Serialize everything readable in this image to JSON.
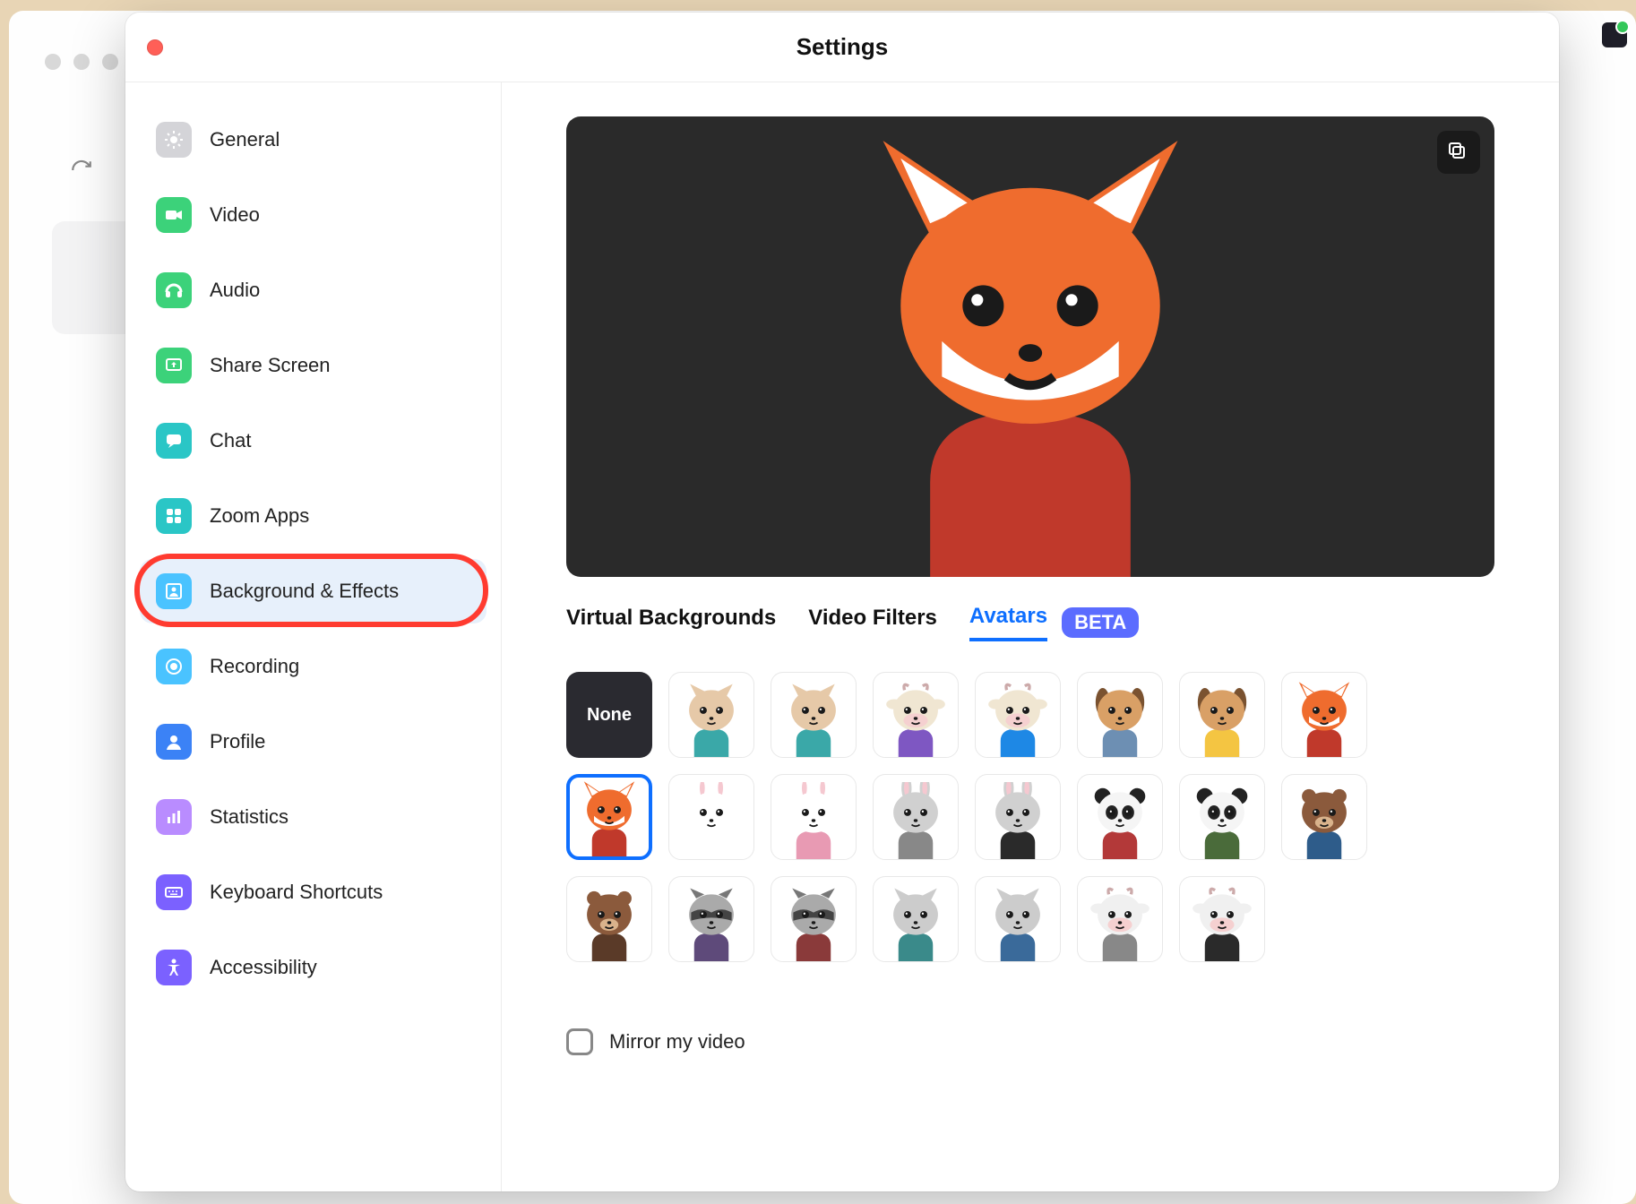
{
  "window": {
    "title": "Settings"
  },
  "sidebar": {
    "items": [
      {
        "id": "general",
        "label": "General",
        "color": "#d4d4d8",
        "active": false,
        "highlight": false
      },
      {
        "id": "video",
        "label": "Video",
        "color": "#3cd27a",
        "active": false,
        "highlight": false
      },
      {
        "id": "audio",
        "label": "Audio",
        "color": "#3cd27a",
        "active": false,
        "highlight": false
      },
      {
        "id": "share-screen",
        "label": "Share Screen",
        "color": "#3cd27a",
        "active": false,
        "highlight": false
      },
      {
        "id": "chat",
        "label": "Chat",
        "color": "#2ac6c6",
        "active": false,
        "highlight": false
      },
      {
        "id": "zoom-apps",
        "label": "Zoom Apps",
        "color": "#2ac6c6",
        "active": false,
        "highlight": false
      },
      {
        "id": "background-effects",
        "label": "Background & Effects",
        "color": "#4ac3ff",
        "active": true,
        "highlight": true
      },
      {
        "id": "recording",
        "label": "Recording",
        "color": "#4ac3ff",
        "active": false,
        "highlight": false
      },
      {
        "id": "profile",
        "label": "Profile",
        "color": "#3b82f6",
        "active": false,
        "highlight": false
      },
      {
        "id": "statistics",
        "label": "Statistics",
        "color": "#b98cff",
        "active": false,
        "highlight": false
      },
      {
        "id": "keyboard-shortcuts",
        "label": "Keyboard Shortcuts",
        "color": "#7b61ff",
        "active": false,
        "highlight": false
      },
      {
        "id": "accessibility",
        "label": "Accessibility",
        "color": "#7b61ff",
        "active": false,
        "highlight": false
      }
    ]
  },
  "tabs": [
    {
      "id": "virtual-backgrounds",
      "label": "Virtual Backgrounds",
      "active": false,
      "badge": null
    },
    {
      "id": "video-filters",
      "label": "Video Filters",
      "active": false,
      "badge": null
    },
    {
      "id": "avatars",
      "label": "Avatars",
      "active": true,
      "badge": "BETA"
    }
  ],
  "avatars": {
    "none_label": "None",
    "selected_index": 8,
    "items": [
      {
        "id": "none",
        "type": "none"
      },
      {
        "id": "cat-teal",
        "animal": "cat",
        "face": "#e6c9a8",
        "shirt": "#3aa8a8"
      },
      {
        "id": "cat-teal2",
        "animal": "cat",
        "face": "#e6c9a8",
        "shirt": "#3aa8a8"
      },
      {
        "id": "cow-purple",
        "animal": "cow",
        "face": "#f0e6d2",
        "shirt": "#7e57c2"
      },
      {
        "id": "cow-blue",
        "animal": "cow",
        "face": "#f0e6d2",
        "shirt": "#1e88e5"
      },
      {
        "id": "dog-blue",
        "animal": "dog",
        "face": "#d9a066",
        "shirt": "#6d8fb3"
      },
      {
        "id": "dog-yellow",
        "animal": "dog",
        "face": "#d9a066",
        "shirt": "#f4c542"
      },
      {
        "id": "fox-red",
        "animal": "fox",
        "face": "#ef6c2e",
        "shirt": "#c0392b"
      },
      {
        "id": "fox-red-sel",
        "animal": "fox",
        "face": "#ef6c2e",
        "shirt": "#c0392b"
      },
      {
        "id": "rabbit-white",
        "animal": "rabbit",
        "face": "#ffffff",
        "shirt": "#ffffff"
      },
      {
        "id": "rabbit-pink",
        "animal": "rabbit",
        "face": "#ffffff",
        "shirt": "#e89ab3"
      },
      {
        "id": "rabbit-grey",
        "animal": "rabbit",
        "face": "#d0d0d0",
        "shirt": "#888888"
      },
      {
        "id": "rabbit-black",
        "animal": "rabbit",
        "face": "#d0d0d0",
        "shirt": "#2a2a2a"
      },
      {
        "id": "panda-red",
        "animal": "panda",
        "face": "#f5f5f5",
        "shirt": "#b33939"
      },
      {
        "id": "panda-green",
        "animal": "panda",
        "face": "#f5f5f5",
        "shirt": "#4a6b3a"
      },
      {
        "id": "bear-blue",
        "animal": "bear",
        "face": "#8b5a3c",
        "shirt": "#2e5c8a"
      },
      {
        "id": "bear-brown",
        "animal": "bear",
        "face": "#8b5a3c",
        "shirt": "#5a3a28"
      },
      {
        "id": "raccoon-purple",
        "animal": "raccoon",
        "face": "#aaaaaa",
        "shirt": "#5e4a7a"
      },
      {
        "id": "raccoon-red",
        "animal": "raccoon",
        "face": "#aaaaaa",
        "shirt": "#8a3a3a"
      },
      {
        "id": "cat-grey-teal",
        "animal": "cat",
        "face": "#cccccc",
        "shirt": "#3a8a8a"
      },
      {
        "id": "cat-grey-blue",
        "animal": "cat",
        "face": "#cccccc",
        "shirt": "#3a6a9a"
      },
      {
        "id": "cow-grey",
        "animal": "cow",
        "face": "#f0f0f0",
        "shirt": "#888888"
      },
      {
        "id": "cow-black",
        "animal": "cow",
        "face": "#f0f0f0",
        "shirt": "#2a2a2a"
      }
    ]
  },
  "preview": {
    "avatar": {
      "animal": "fox",
      "face": "#ef6c2e",
      "shirt": "#c0392b"
    }
  },
  "mirror": {
    "label": "Mirror my video",
    "checked": false
  }
}
